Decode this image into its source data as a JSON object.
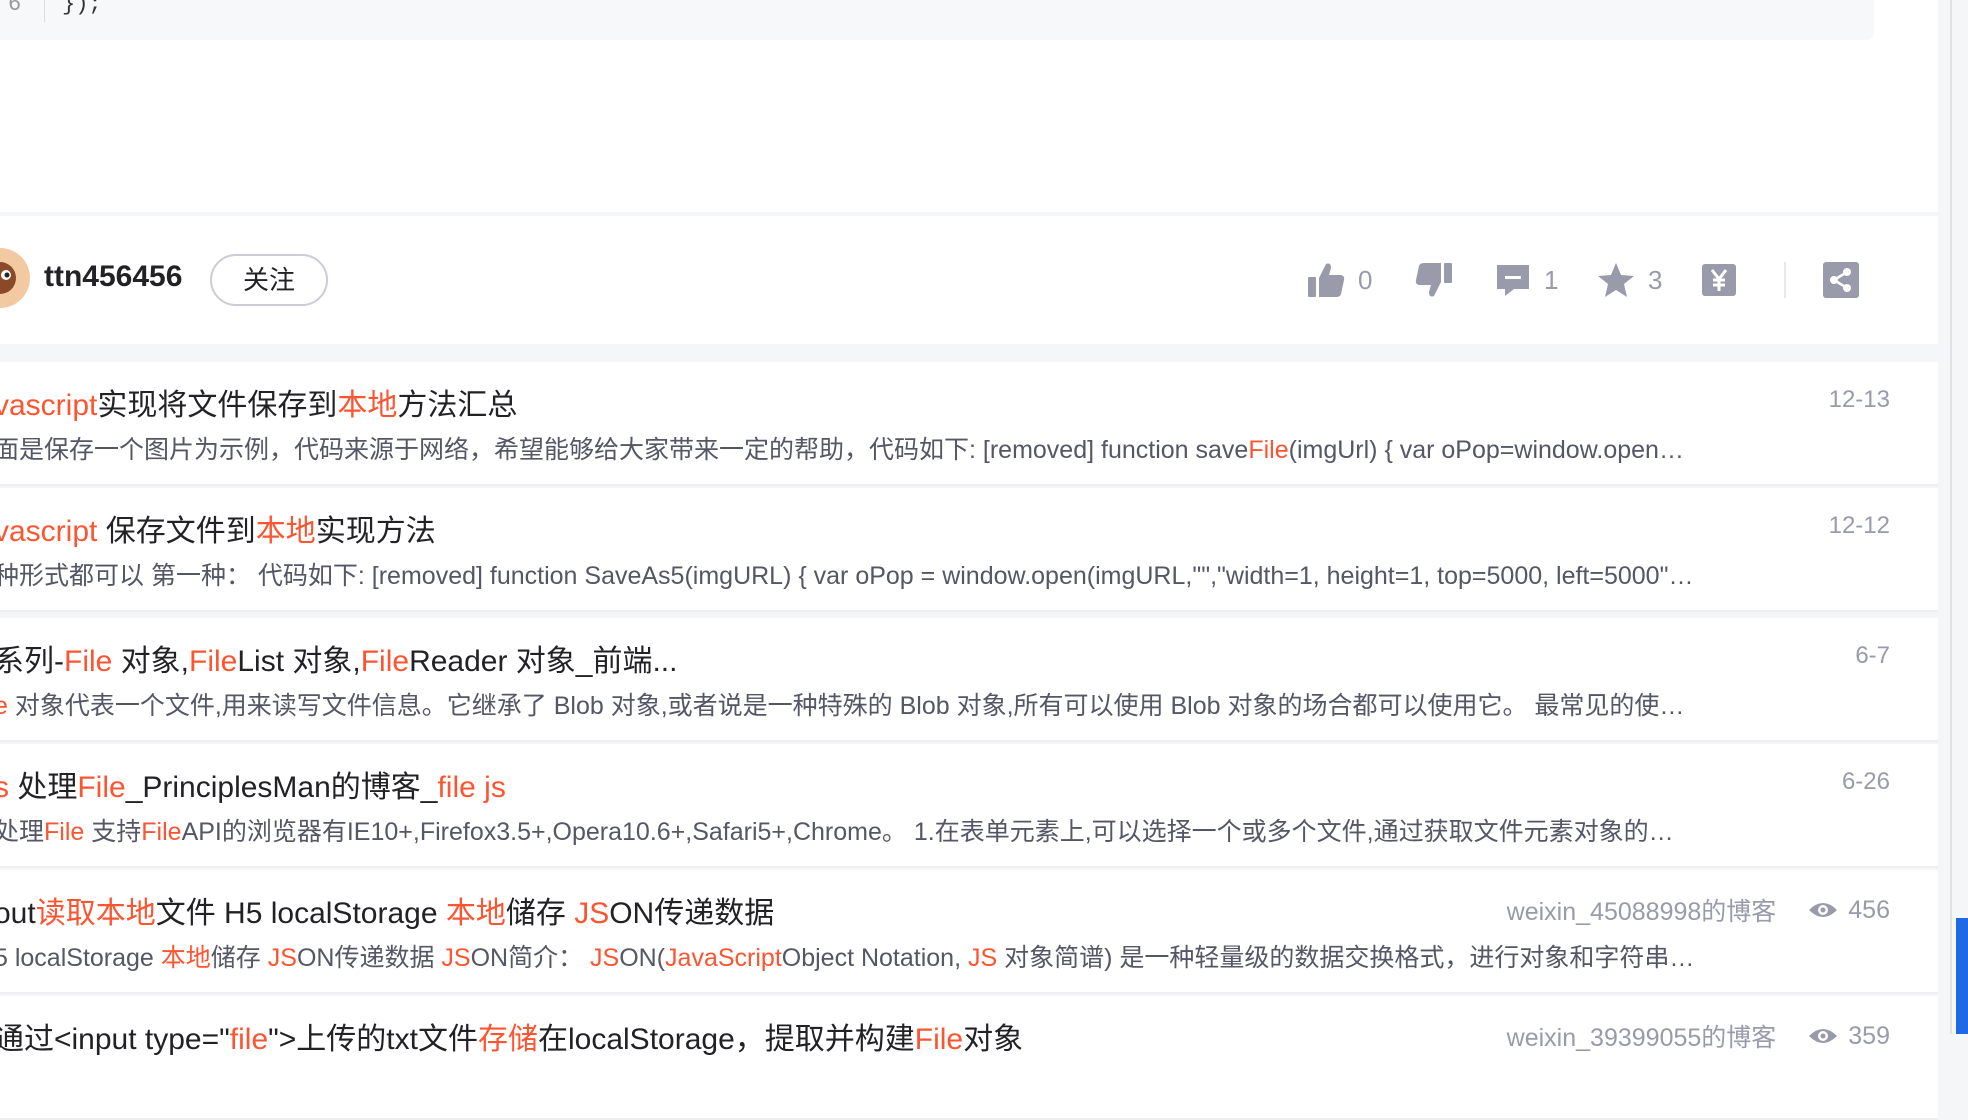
{
  "code": {
    "line_number": "6",
    "text": "});"
  },
  "author": {
    "name": "ttn456456",
    "follow_label": "关注"
  },
  "toolbar": {
    "like_count": "0",
    "comment_count": "1",
    "collect_count": "3"
  },
  "list": [
    {
      "title": [
        {
          "t": "vascript",
          "h": true
        },
        {
          "t": "实现将文件保存到",
          "h": false
        },
        {
          "t": "本地",
          "h": true
        },
        {
          "t": "方法汇总",
          "h": false
        }
      ],
      "desc": [
        {
          "t": "面是保存一个图片为示例，代码来源于网络，希望能够给大家带来一定的帮助，代码如下: [removed] function save",
          "h": false
        },
        {
          "t": "File",
          "h": true
        },
        {
          "t": "(imgUrl) { var oPop=window.open…",
          "h": false
        }
      ],
      "date": "12-13"
    },
    {
      "title": [
        {
          "t": "vascript",
          "h": true
        },
        {
          "t": " 保存文件到",
          "h": false
        },
        {
          "t": "本地",
          "h": true
        },
        {
          "t": "实现方法",
          "h": false
        }
      ],
      "desc": [
        {
          "t": "种形式都可以 第一种： 代码如下: [removed] function SaveAs5(imgURL) { var oPop = window.open(imgURL,\"\",\"width=1, height=1, top=5000, left=5000\"…",
          "h": false
        }
      ],
      "date": "12-12"
    },
    {
      "title": [
        {
          "t": "系列-",
          "h": false
        },
        {
          "t": "File",
          "h": true
        },
        {
          "t": " 对象,",
          "h": false
        },
        {
          "t": "File",
          "h": true
        },
        {
          "t": "List 对象,",
          "h": false
        },
        {
          "t": "File",
          "h": true
        },
        {
          "t": "Reader 对象_前端...",
          "h": false
        }
      ],
      "desc": [
        {
          "t": "e",
          "h": true
        },
        {
          "t": " 对象代表一个文件,用来读写文件信息。它继承了 Blob 对象,或者说是一种特殊的 Blob 对象,所有可以使用 Blob 对象的场合都可以使用它。 最常见的使…",
          "h": false
        }
      ],
      "date": "6-7"
    },
    {
      "title": [
        {
          "t": "s",
          "h": true
        },
        {
          "t": " 处理",
          "h": false
        },
        {
          "t": "File",
          "h": true
        },
        {
          "t": "_PrinciplesMan的博客_",
          "h": false
        },
        {
          "t": "file js",
          "h": true
        }
      ],
      "desc": [
        {
          "t": " 处理",
          "h": false
        },
        {
          "t": "File",
          "h": true
        },
        {
          "t": " 支持",
          "h": false
        },
        {
          "t": "File",
          "h": true
        },
        {
          "t": "API的浏览器有IE10+,Firefox3.5+,Opera10.6+,Safari5+,Chrome。 1.在表单元素上,可以选择一个或多个文件,通过获取文件元素对象的…",
          "h": false
        }
      ],
      "date": "6-26"
    },
    {
      "title": [
        {
          "t": "out",
          "h": false
        },
        {
          "t": "读取本地",
          "h": true
        },
        {
          "t": "文件 H5 localStorage ",
          "h": false
        },
        {
          "t": "本地",
          "h": true
        },
        {
          "t": "储存 ",
          "h": false
        },
        {
          "t": "JS",
          "h": true
        },
        {
          "t": "ON传递数据",
          "h": false
        }
      ],
      "desc": [
        {
          "t": "5 localStorage ",
          "h": false
        },
        {
          "t": "本地",
          "h": true
        },
        {
          "t": "储存 ",
          "h": false
        },
        {
          "t": "JS",
          "h": true
        },
        {
          "t": "ON传递数据 ",
          "h": false
        },
        {
          "t": "JS",
          "h": true
        },
        {
          "t": "ON简介： ",
          "h": false
        },
        {
          "t": "JS",
          "h": true
        },
        {
          "t": "ON(",
          "h": false
        },
        {
          "t": "JavaScript",
          "h": true
        },
        {
          "t": "Object Notation, ",
          "h": false
        },
        {
          "t": "JS",
          "h": true
        },
        {
          "t": " 对象简谱) 是一种轻量级的数据交换格式，进行对象和字符串…",
          "h": false
        }
      ],
      "source": "weixin_45088998的博客",
      "views": "456"
    },
    {
      "title": [
        {
          "t": "通过<input type=\"",
          "h": false
        },
        {
          "t": "file",
          "h": true
        },
        {
          "t": "\">上传的txt文件",
          "h": false
        },
        {
          "t": "存储",
          "h": true
        },
        {
          "t": "在localStorage，提取并构建",
          "h": false
        },
        {
          "t": "File",
          "h": true
        },
        {
          "t": "对象",
          "h": false
        }
      ],
      "desc": [],
      "source": "weixin_39399055的博客",
      "views": "359"
    }
  ]
}
